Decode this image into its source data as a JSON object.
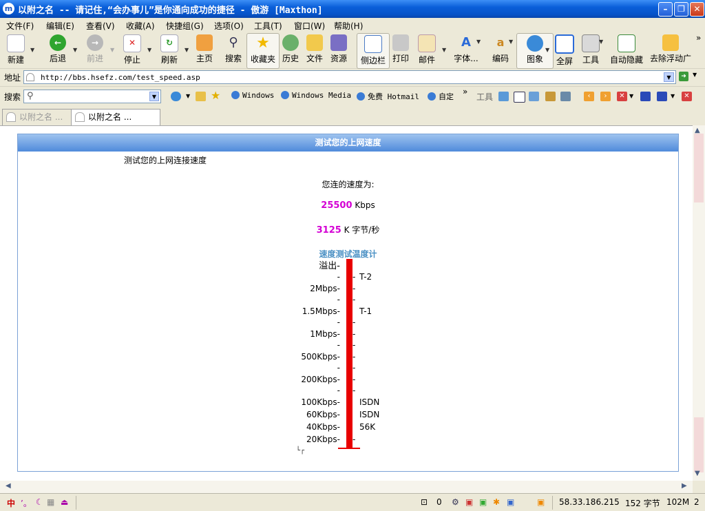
{
  "window": {
    "app_icon": "m",
    "title": "以附之名 -- 请记住,“会办事儿”是你通向成功的捷径 - 傲游 [Maxthon]",
    "controls": [
      "minimize-icon",
      "restore-icon",
      "close-icon"
    ]
  },
  "menu": [
    "文件(F)",
    "编辑(E)",
    "查看(V)",
    "收藏(A)",
    "快捷组(G)",
    "选项(O)",
    "工具(T)",
    "窗口(W)",
    "帮助(H)"
  ],
  "toolbar": {
    "new": "新建",
    "back": "后退",
    "forward": "前进",
    "stop": "停止",
    "refresh": "刷新",
    "home": "主页",
    "search": "搜索",
    "favorites": "收藏夹",
    "history": "历史",
    "files": "文件",
    "resources": "资源",
    "sidebar": "侧边栏",
    "print": "打印",
    "mail": "邮件",
    "font": "字体...",
    "encoding": "编码",
    "images": "图象",
    "fullscreen": "全屏",
    "tools": "工具",
    "autohide": "自动隐藏",
    "remove_float": "去除浮动广",
    "overflow": "»"
  },
  "address": {
    "label": "地址",
    "url": "http://bbs.hsefz.com/test_speed.asp"
  },
  "searchbar": {
    "label": "搜索",
    "links": [
      "Windows",
      "Windows Media",
      "免费 Hotmail",
      "自定"
    ],
    "overflow": "»",
    "tools_label": "工具"
  },
  "tabs": [
    {
      "label": "以附之名 ...",
      "active": false
    },
    {
      "label": "以附之名 ...",
      "active": true
    }
  ],
  "page": {
    "header": "测试您的上网速度",
    "subtitle": "测试您的上网连接速度",
    "speed_prefix": "您连的速度为:",
    "kbps_value": "25500",
    "kbps_unit": " Kbps",
    "kbytes_value": "3125",
    "kbytes_unit": " K 字节/秒",
    "gauge_title": "速度测试温度计",
    "gauge_overflow": "溢出-",
    "gauge_levels": [
      "2Mbps-",
      "1.5Mbps-",
      "1Mbps-",
      "500Kbps-",
      "200Kbps-",
      "100Kbps-",
      "60Kbps-",
      "40Kbps-",
      "20Kbps-"
    ],
    "gauge_right": [
      "T-2",
      "T-1",
      "ISDN",
      "ISDN",
      "56K"
    ],
    "gauge_fill_fraction": 1.0,
    "corner_mark": "└┌"
  },
  "status": {
    "ime": "中",
    "popup_count": "0",
    "ip": "58.33.186.215",
    "bytes": "152 字节",
    "memory": "102M",
    "windows": "2"
  },
  "colors": {
    "accent": "#0a5fd9",
    "magenta": "#d400d4",
    "gauge": "#e80000",
    "gauge_title": "#4a90c4"
  }
}
